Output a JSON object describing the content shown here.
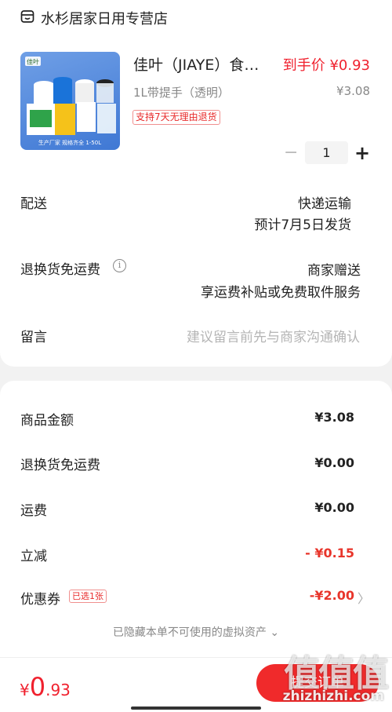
{
  "store": {
    "name": "水杉居家日用专营店",
    "icon": "store-icon"
  },
  "product": {
    "image_brand": "佳叶",
    "image_caption": "生产厂家 规格齐全 1-50L",
    "title": "佳叶（JIAYE）食…",
    "pay_price": "到手价 ¥0.93",
    "variant": "1L带提手（透明）",
    "original_price": "¥3.08",
    "badge": "支持7天无理由退货",
    "quantity": "1",
    "minus": "−",
    "plus": "+"
  },
  "delivery": {
    "label": "配送",
    "method": "快递运输",
    "estimate": "预计7月5日发货"
  },
  "return_shipping": {
    "label": "退换货免运费",
    "value": "商家赠送",
    "detail": "享运费补贴或免费取件服务",
    "info_icon": "info-icon"
  },
  "message": {
    "label": "留言",
    "placeholder": "建议留言前先与商家沟通确认"
  },
  "summary": {
    "items": [
      {
        "label": "商品金额",
        "value": "¥3.08"
      },
      {
        "label": "退换货免运费",
        "value": "¥0.00"
      },
      {
        "label": "运费",
        "value": "¥0.00"
      },
      {
        "label": "立减",
        "value": "- ¥0.15"
      }
    ],
    "coupon": {
      "label": "优惠券",
      "badge": "已选1张",
      "value": "-¥2.00",
      "arrow": "〉"
    },
    "hidden_note": "已隐藏本单不可使用的虚拟资产 ⌄"
  },
  "footer": {
    "currency": "¥",
    "total_int": "0",
    "total_dec": ".93",
    "submit_label": "提交订单"
  },
  "watermark": {
    "logo": "值值值",
    "text": "zhizhizhi.com"
  },
  "colors": {
    "accent": "#f0212e",
    "badge_border": "#f0908f",
    "muted": "#888888"
  }
}
